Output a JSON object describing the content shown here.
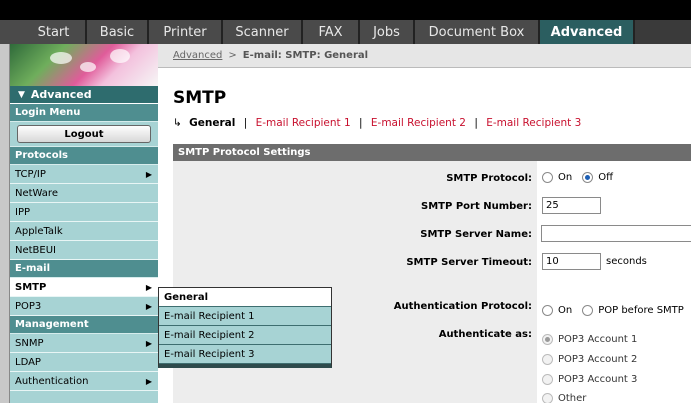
{
  "tabs": [
    {
      "label": "Start"
    },
    {
      "label": "Basic"
    },
    {
      "label": "Printer"
    },
    {
      "label": "Scanner"
    },
    {
      "label": "FAX"
    },
    {
      "label": "Jobs"
    },
    {
      "label": "Document Box"
    },
    {
      "label": "Advanced"
    }
  ],
  "sidebar": {
    "header": "Advanced",
    "login_menu": "Login Menu",
    "logout_label": "Logout",
    "protocols": "Protocols",
    "protocol_items": [
      {
        "label": "TCP/IP"
      },
      {
        "label": "NetWare"
      },
      {
        "label": "IPP"
      },
      {
        "label": "AppleTalk"
      },
      {
        "label": "NetBEUI"
      }
    ],
    "email": "E-mail",
    "email_items": [
      {
        "label": "SMTP"
      },
      {
        "label": "POP3"
      }
    ],
    "management": "Management",
    "management_items": [
      {
        "label": "SNMP"
      },
      {
        "label": "LDAP"
      },
      {
        "label": "Authentication"
      }
    ]
  },
  "flyout": [
    {
      "label": "General"
    },
    {
      "label": "E-mail Recipient 1"
    },
    {
      "label": "E-mail Recipient 2"
    },
    {
      "label": "E-mail Recipient 3"
    }
  ],
  "breadcrumb": {
    "parent": "Advanced",
    "separator": ">",
    "current": "E-mail: SMTP: General"
  },
  "page_title": "SMTP",
  "subnav": {
    "current": "General",
    "links": [
      "E-mail Recipient 1",
      "E-mail Recipient 2",
      "E-mail Recipient 3"
    ]
  },
  "section_header": "SMTP Protocol Settings",
  "form": {
    "smtp_protocol_label": "SMTP Protocol:",
    "on_label": "On",
    "off_label": "Off",
    "smtp_protocol_value": "Off",
    "port_label": "SMTP Port Number:",
    "port_value": "25",
    "server_name_label": "SMTP Server Name:",
    "server_name_value": "",
    "timeout_label": "SMTP Server Timeout:",
    "timeout_value": "10",
    "timeout_unit": "seconds",
    "auth_protocol_label": "Authentication Protocol:",
    "auth_on_label": "On",
    "auth_pop_label": "POP before SMTP",
    "auth_as_label": "Authenticate as:",
    "auth_as_options": [
      "POP3 Account 1",
      "POP3 Account 2",
      "POP3 Account 3",
      "Other"
    ],
    "auth_as_selected": "POP3 Account 1"
  }
}
